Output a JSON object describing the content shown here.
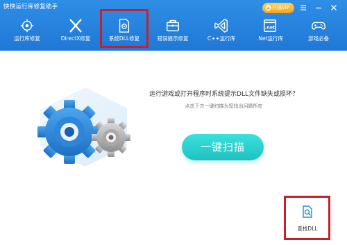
{
  "app": {
    "title": "快快运行库修复助手",
    "vip_label": "开通VIP"
  },
  "nav": {
    "items": [
      {
        "label": "运行库修复",
        "icon": "target-icon"
      },
      {
        "label": "DirectX修复",
        "icon": "x-logo-icon"
      },
      {
        "label": "系统DLL修复",
        "icon": "gear-file-icon",
        "selected": true
      },
      {
        "label": "错误提示修复",
        "icon": "toolbox-icon"
      },
      {
        "label": "C++运行库",
        "icon": "vs-logo-icon"
      },
      {
        "label": ".Net运行库",
        "icon": "net-window-icon"
      },
      {
        "label": "游戏必备",
        "icon": "gamepad-icon"
      }
    ]
  },
  "main": {
    "question": "运行游戏或打开程序时系统提示DLL文件缺失或损坏？",
    "hint": "点击下方一键扫描为您找出问题所在",
    "scan_label": "一键扫描",
    "find_dll_label": "查找DLL"
  },
  "colors": {
    "header": "#2482dc",
    "accent": "#22c7c4",
    "highlight": "#c8202a",
    "vip": "#f7b02b"
  }
}
